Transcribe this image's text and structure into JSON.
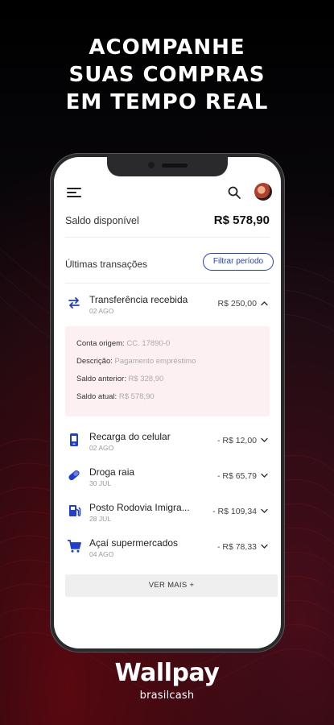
{
  "headline": {
    "line1": "ACOMPANHE",
    "line2": "SUAS COMPRAS",
    "line3": "EM TEMPO REAL"
  },
  "app": {
    "balance": {
      "label": "Saldo disponível",
      "value": "R$ 578,90"
    },
    "transactions_title": "Últimas transações",
    "filter_label": "Filtrar período",
    "transactions": [
      {
        "name": "Transferência recebida",
        "date": "02 AGO",
        "amount": "R$ 250,00",
        "icon": "transfer-icon",
        "expanded": true
      },
      {
        "name": "Recarga do celular",
        "date": "02 AGO",
        "amount": "- R$ 12,00",
        "icon": "phone-icon"
      },
      {
        "name": "Droga raia",
        "date": "30 JUL",
        "amount": "- R$ 65,79",
        "icon": "pill-icon"
      },
      {
        "name": "Posto Rodovia Imigra...",
        "date": "28 JUL",
        "amount": "- R$ 109,34",
        "icon": "fuel-icon"
      },
      {
        "name": "Açaí supermercados",
        "date": "04 AGO",
        "amount": "- R$ 78,33",
        "icon": "cart-icon"
      }
    ],
    "details": {
      "origin_label": "Conta origem:",
      "origin_value": "CC. 17890-0",
      "desc_label": "Descrição:",
      "desc_value": "Pagamento empréstimo",
      "prev_label": "Saldo anterior:",
      "prev_value": "R$ 328,90",
      "curr_label": "Saldo atual:",
      "curr_value": "R$ 578,90"
    },
    "see_more": "VER MAIS +"
  },
  "brand": {
    "name": "Wallpay",
    "sub": "brasilcash"
  },
  "colors": {
    "accent": "#1f3fd1",
    "background": "#0b0b0d",
    "details_bg": "#fdf0f2"
  }
}
